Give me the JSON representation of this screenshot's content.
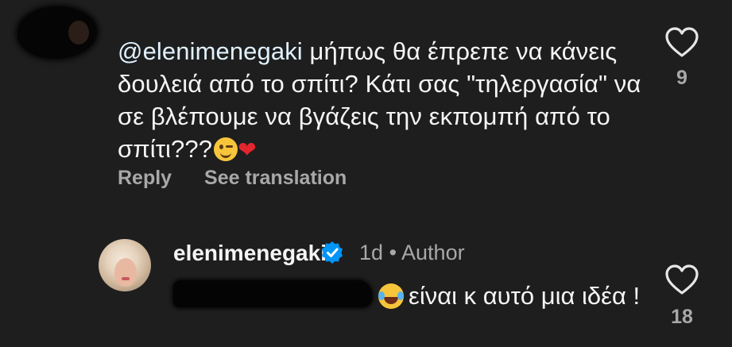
{
  "comments": [
    {
      "mention": "@elenimenegaki",
      "text": " μήπως θα έπρεπε να κάνεις δουλειά από το σπίτι? Κάτι σας \"τηλεργασία\" να σε βλέπουμε να βγάζεις την εκπομπή από το σπίτι???",
      "emojis": [
        "winking-face",
        "red-heart"
      ],
      "heart_glyph": "❤",
      "actions": {
        "reply": "Reply",
        "translate": "See translation"
      },
      "likes": "9"
    },
    {
      "username": "elenimenegaki",
      "verified": true,
      "time": "1d",
      "separator": "•",
      "role": "Author",
      "emoji": "face-with-tears-of-joy",
      "text": "είναι κ αυτό μια ιδέα !",
      "likes": "18"
    }
  ],
  "colors": {
    "background": "#1e1e1e",
    "text": "#f5f5f5",
    "secondary": "#a8a8a8",
    "verified": "#0095f6",
    "heart": "#e3262e"
  }
}
